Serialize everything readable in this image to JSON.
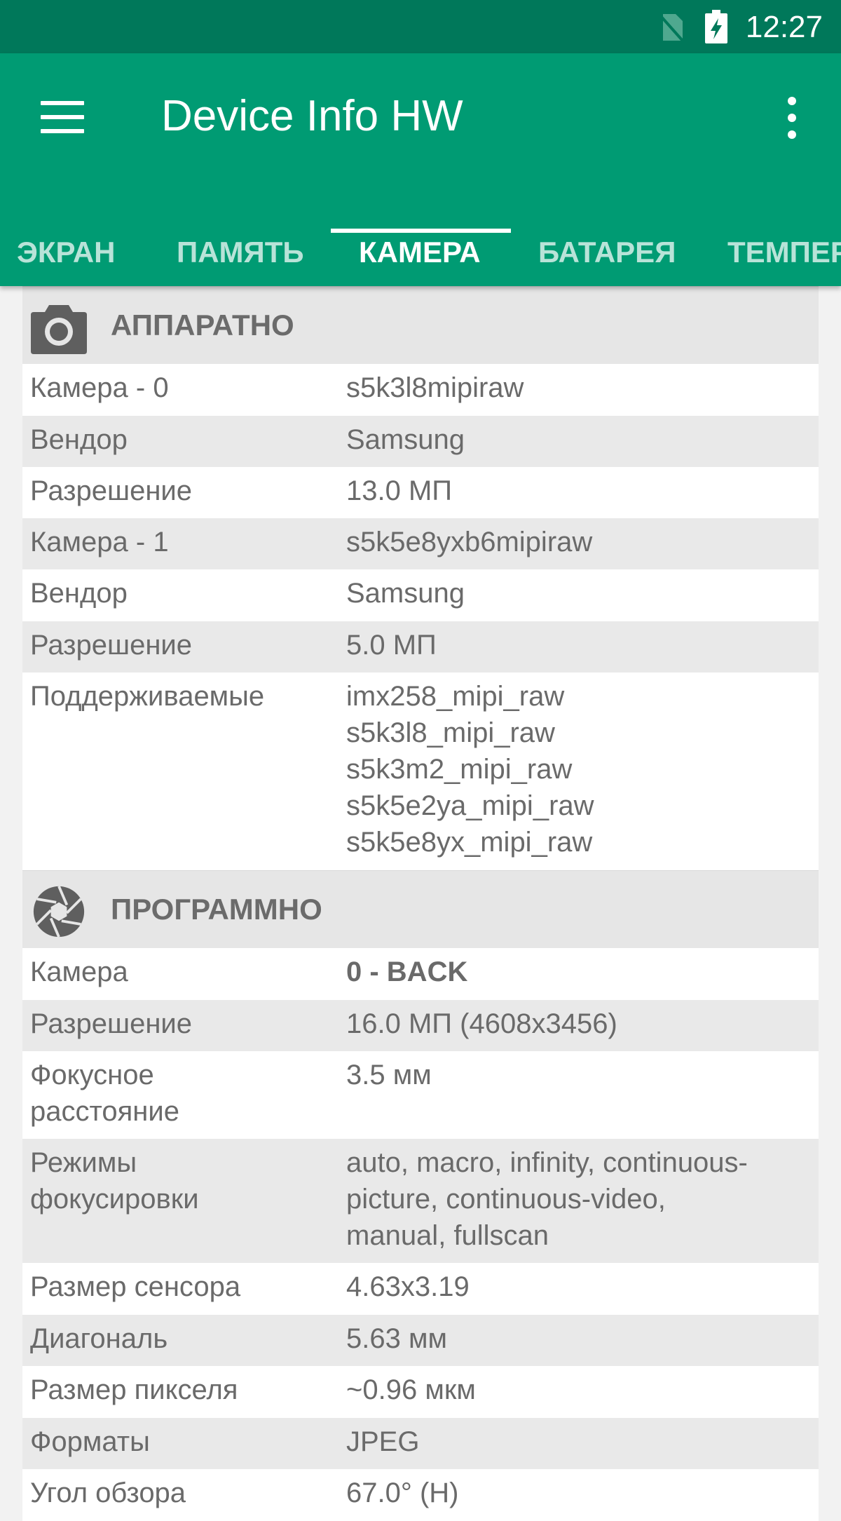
{
  "status": {
    "time": "12:27"
  },
  "app": {
    "title": "Device Info HW"
  },
  "tabs": [
    {
      "label": "ЭКРАН"
    },
    {
      "label": "ПАМЯТЬ"
    },
    {
      "label": "КАМЕРА"
    },
    {
      "label": "БАТАРЕЯ"
    },
    {
      "label": "ТЕМПЕР"
    }
  ],
  "colors": {
    "statusbar": "#00785a",
    "appbar": "#009b73",
    "indicator": "#ffffff"
  },
  "hardware": {
    "title": "АППАРАТНО",
    "icon": "camera-icon",
    "rows": [
      {
        "label": "Камера - 0",
        "value": "s5k3l8mipiraw"
      },
      {
        "label": "Вендор",
        "value": "Samsung"
      },
      {
        "label": "Разрешение",
        "value": "13.0 МП"
      },
      {
        "label": "Камера - 1",
        "value": "s5k5e8yxb6mipiraw"
      },
      {
        "label": "Вендор",
        "value": "Samsung"
      },
      {
        "label": "Разрешение",
        "value": "5.0 МП"
      },
      {
        "label": "Поддерживаемые",
        "value_lines": [
          "imx258_mipi_raw",
          "s5k3l8_mipi_raw",
          "s5k3m2_mipi_raw",
          "s5k5e2ya_mipi_raw",
          "s5k5e8yx_mipi_raw"
        ]
      }
    ]
  },
  "software": {
    "title": "ПРОГРАММНО",
    "icon": "aperture-icon",
    "rows": [
      {
        "label": "Камера",
        "value": "0 - BACK"
      },
      {
        "label": "Разрешение",
        "value": "16.0 МП (4608x3456)"
      },
      {
        "label_lines": [
          "Фокусное",
          "расстояние"
        ],
        "value": "3.5 мм"
      },
      {
        "label_lines": [
          "Режимы",
          "фокусировки"
        ],
        "value_lines": [
          "auto, macro, infinity, continuous-",
          "picture, continuous-video,",
          "manual, fullscan"
        ]
      },
      {
        "label": "Размер сенсора",
        "value": "4.63x3.19"
      },
      {
        "label": "Диагональ",
        "value": "5.63 мм"
      },
      {
        "label": "Размер пикселя",
        "value": "~0.96 мкм"
      },
      {
        "label": "Форматы",
        "value": "JPEG"
      },
      {
        "label": "Угол обзора",
        "value": "67.0° (H)"
      }
    ]
  }
}
